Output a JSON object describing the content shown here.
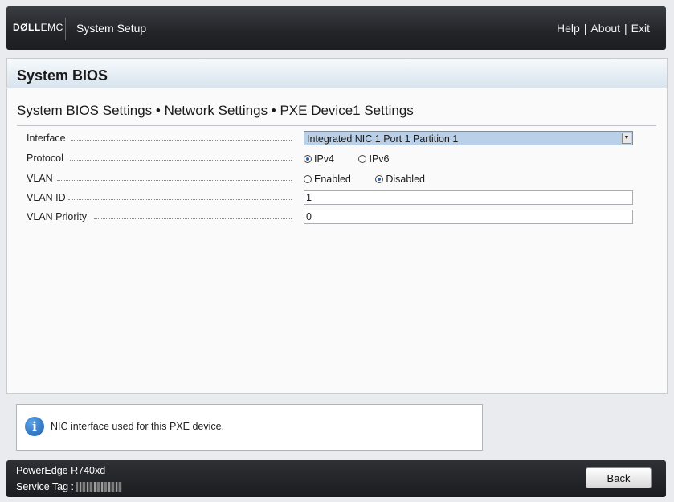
{
  "header": {
    "logo_dell": "DØLL",
    "logo_emc": "EMC",
    "title": "System Setup",
    "nav": {
      "help": "Help",
      "about": "About",
      "exit": "Exit",
      "separator": "|"
    }
  },
  "page": {
    "title": "System BIOS",
    "breadcrumb": "System BIOS Settings • Network Settings • PXE Device1 Settings"
  },
  "settings": {
    "interface": {
      "label": "Interface",
      "value": "Integrated NIC 1 Port 1 Partition 1"
    },
    "protocol": {
      "label": "Protocol",
      "options": [
        {
          "label": "IPv4",
          "selected": true
        },
        {
          "label": "IPv6",
          "selected": false
        }
      ]
    },
    "vlan": {
      "label": "VLAN",
      "options": [
        {
          "label": "Enabled",
          "selected": false
        },
        {
          "label": "Disabled",
          "selected": true
        }
      ]
    },
    "vlan_id": {
      "label": "VLAN ID",
      "value": "1"
    },
    "vlan_priority": {
      "label": "VLAN Priority",
      "value": "0"
    }
  },
  "help": {
    "text": "NIC interface used for this PXE device.",
    "icon": "info-icon"
  },
  "footer": {
    "model": "PowerEdge R740xd",
    "service_tag_label": "Service Tag :",
    "back_label": "Back"
  },
  "colors": {
    "header_bg": "#222428",
    "bios_bar": "#d8e4ee",
    "select_bg": "#b9d0e8",
    "radio_dot": "#2a5fb0"
  }
}
